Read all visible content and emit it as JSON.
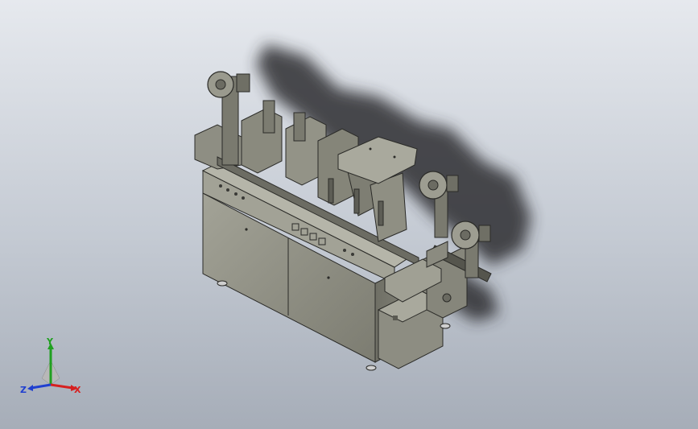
{
  "viewport": {
    "background_top": "#e6e9ee",
    "background_bottom": "#a6adb8"
  },
  "model": {
    "body_color": "#8a8a7e",
    "edge_color": "#2b2b28",
    "shadow_color": "#2e2e30",
    "panel_color": "#9c9c90"
  },
  "triad": {
    "x_label": "X",
    "y_label": "Y",
    "z_label": "Z",
    "x_color": "#d62020",
    "y_color": "#20a020",
    "z_color": "#2040d0"
  }
}
